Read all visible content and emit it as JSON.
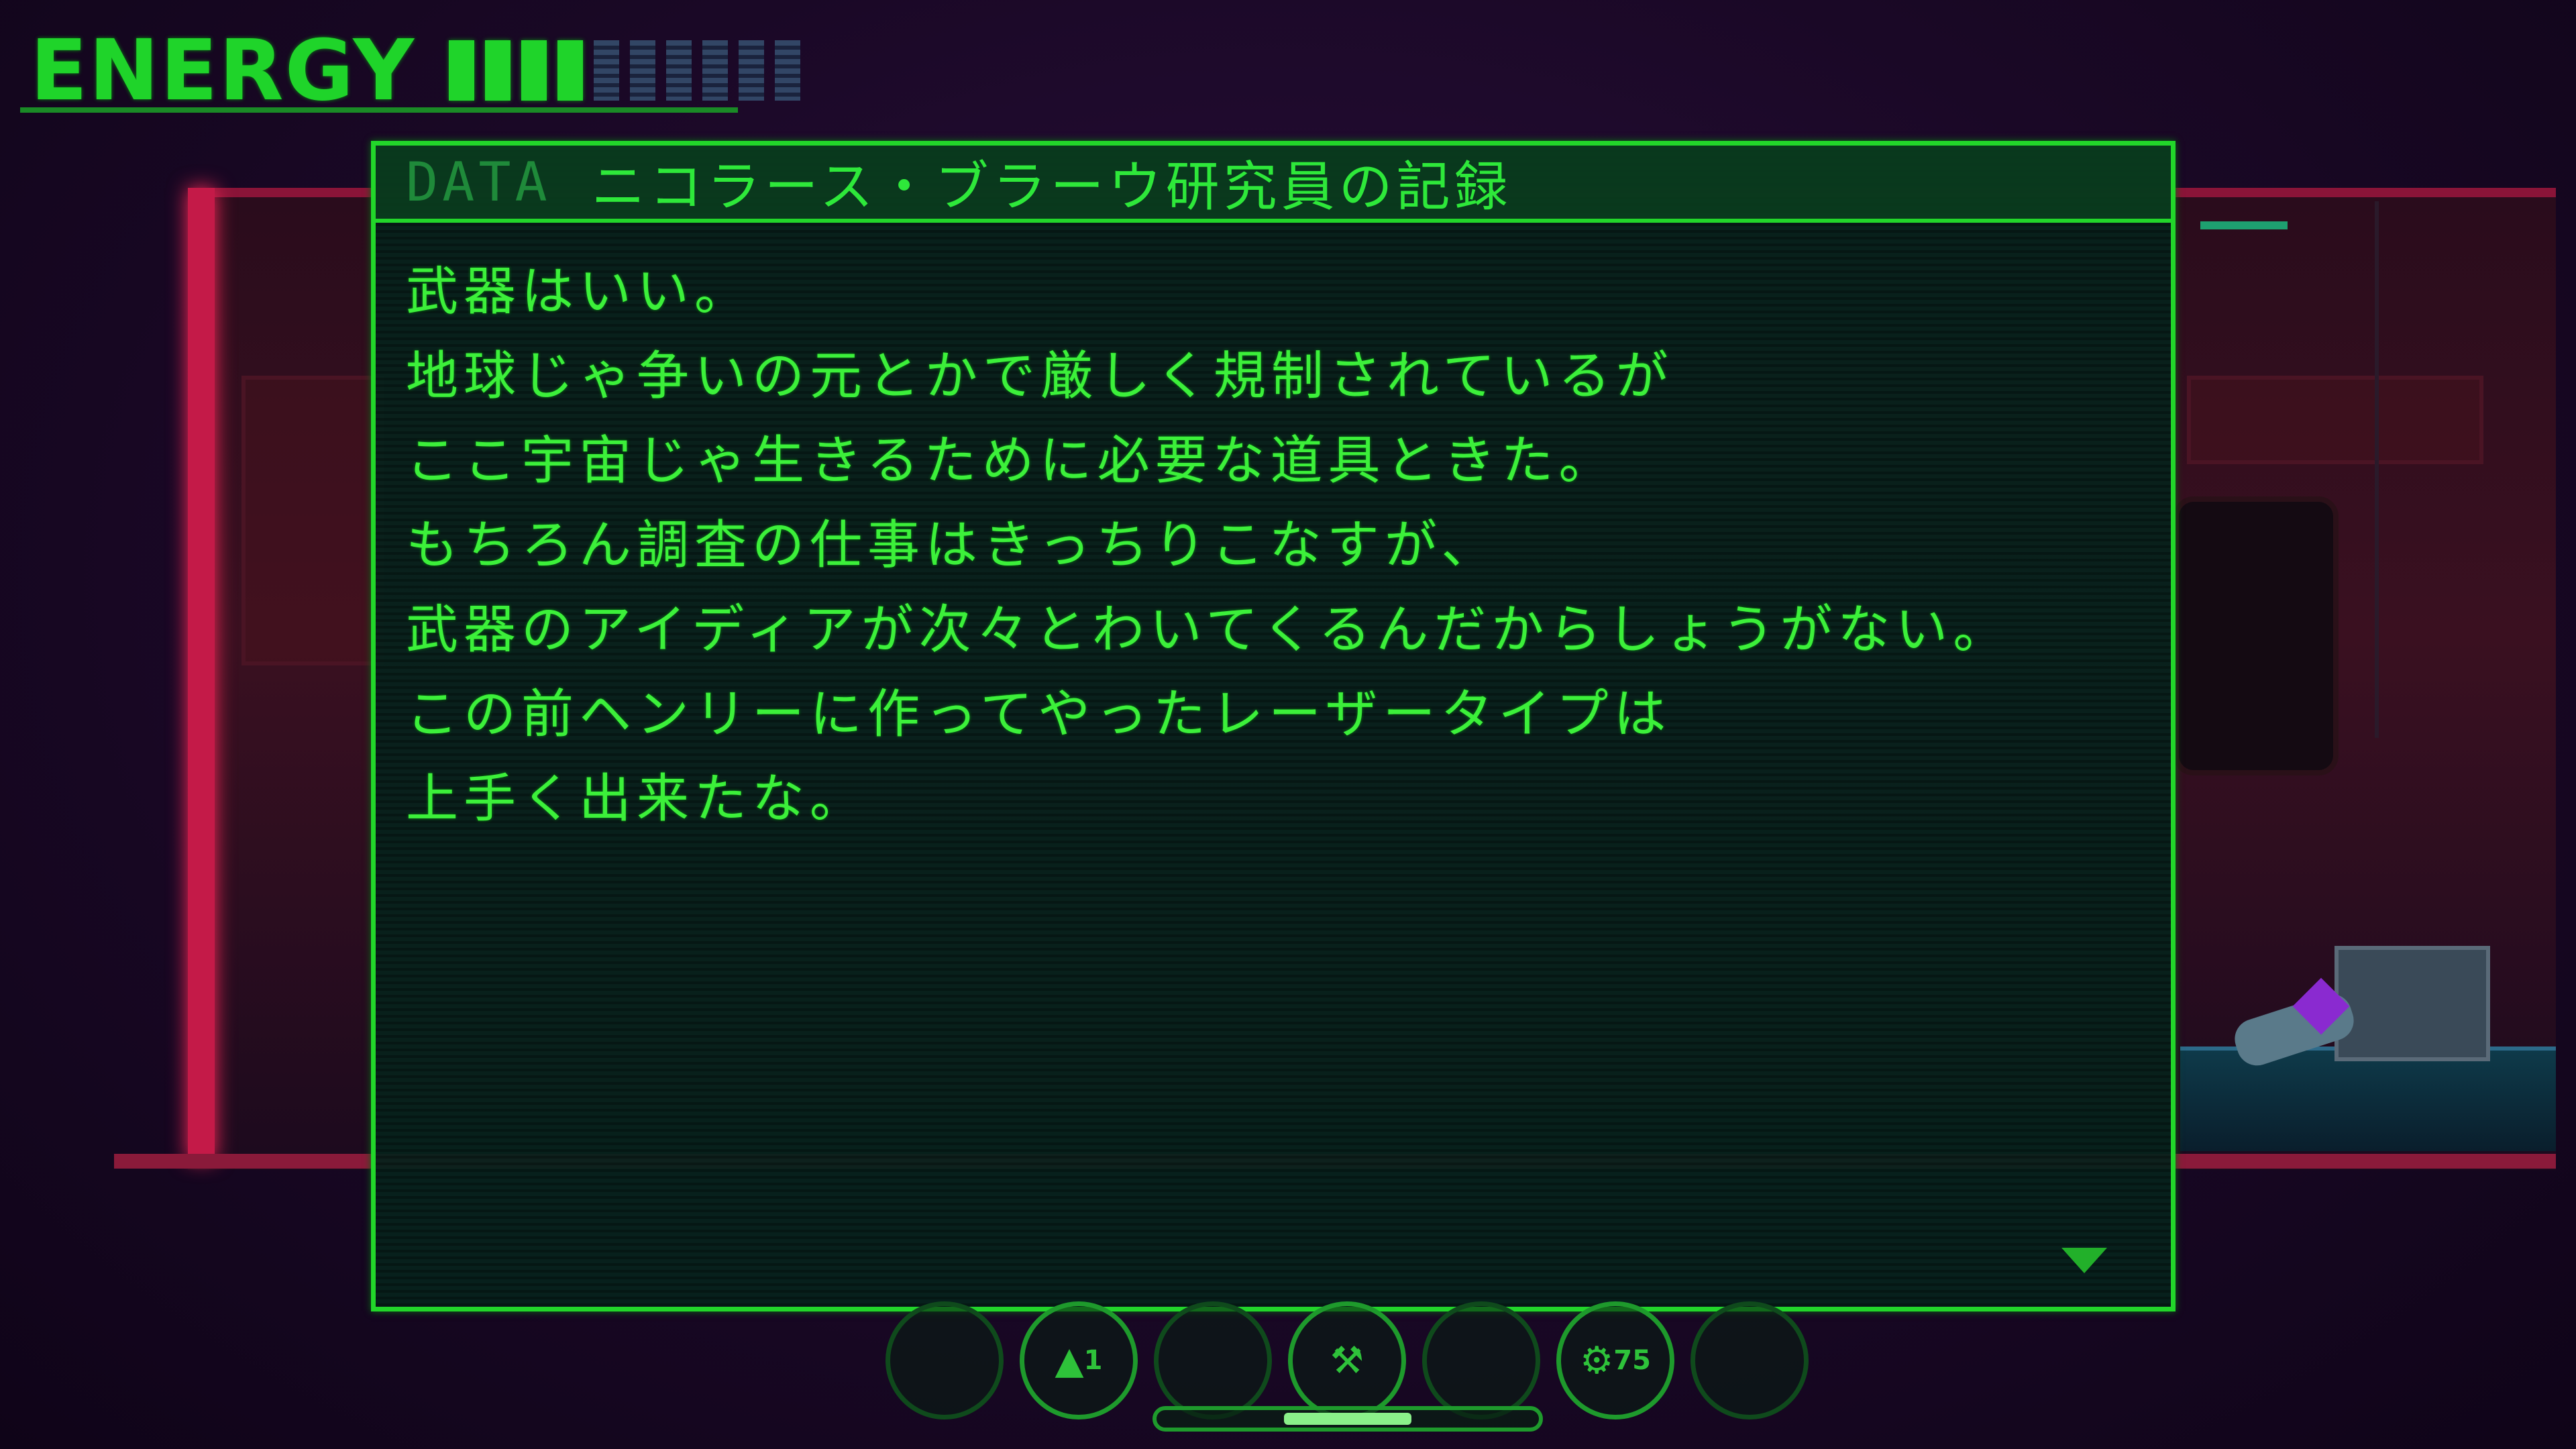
{
  "hud": {
    "energy_label": "ENERGY",
    "energy_level": 4,
    "energy_max": 10,
    "energy_color": "#1fd42a"
  },
  "dialog": {
    "tag": "DATA",
    "title": "ニコラース・ブラーウ研究員の記録",
    "lines": [
      "武器はいい。",
      "地球じゃ争いの元とかで厳しく規制されているが",
      "ここ宇宙じゃ生きるために必要な道具ときた。",
      "もちろん調査の仕事はきっちりこなすが、",
      "武器のアイディアが次々とわいてくるんだからしょうがない。",
      "この前ヘンリーに作ってやったレーザータイプは",
      "上手く出来たな。"
    ],
    "more_indicator": "arrow-down-icon",
    "border_color": "#22d62a"
  },
  "item_ring": {
    "slots": [
      {
        "icon": "empty-slot",
        "label": ""
      },
      {
        "icon": "blaster-icon",
        "label": "1"
      },
      {
        "icon": "empty-slot",
        "label": ""
      },
      {
        "icon": "wrench-icon",
        "label": ""
      },
      {
        "icon": "empty-slot",
        "label": ""
      },
      {
        "icon": "gear-icon",
        "label": "75"
      },
      {
        "icon": "empty-slot",
        "label": ""
      }
    ],
    "selected_index": 1
  }
}
